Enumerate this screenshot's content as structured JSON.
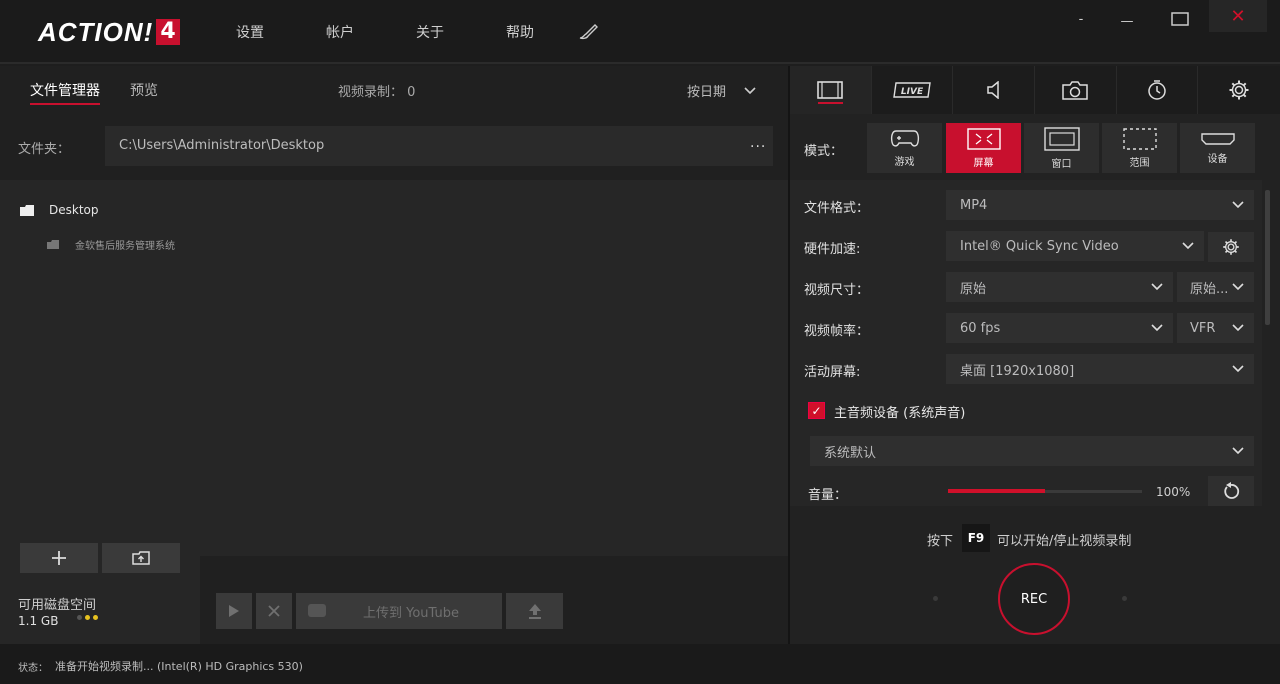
{
  "app": {
    "logo_text": "ACTION!",
    "logo_version": "4"
  },
  "menu": [
    {
      "label": "设置"
    },
    {
      "label": "帐户"
    },
    {
      "label": "关于"
    },
    {
      "label": "帮助"
    }
  ],
  "window": {
    "minimize_small": "-",
    "minimize": "—",
    "close": "✕"
  },
  "left": {
    "tabs": {
      "file_manager": "文件管理器",
      "preview": "预览"
    },
    "rec_count": "视频录制： 0",
    "sort": "按日期",
    "folder_label": "文件夹：",
    "folder_path": "C:\\Users\\Administrator\\Desktop",
    "folder_more": "...",
    "tree": [
      {
        "label": "Desktop"
      },
      {
        "label": "金软售后服务管理系统"
      }
    ],
    "disk_label": "可用磁盘空间",
    "disk_value": "1.1 GB",
    "youtube_label": "上传到 YouTube"
  },
  "right": {
    "tabs": [
      "video-icon",
      "live-icon",
      "audio-icon",
      "camera-icon",
      "timer-icon",
      "gear-icon"
    ],
    "live_text": "LIVE",
    "mode_label": "模式：",
    "modes": [
      {
        "label": "游戏"
      },
      {
        "label": "屏幕"
      },
      {
        "label": "窗口"
      },
      {
        "label": "范围"
      },
      {
        "label": "设备"
      }
    ],
    "settings": {
      "format_label": "文件格式：",
      "format_value": "MP4",
      "hw_label": "硬件加速:",
      "hw_value": "Intel® Quick Sync Video",
      "size_label": "视频尺寸：",
      "size_value": "原始",
      "size_value2": "原始...",
      "fps_label": "视频帧率：",
      "fps_value": "60 fps",
      "fps_mode": "VFR",
      "screen_label": "活动屏幕:",
      "screen_value": "桌面 [1920x1080]"
    },
    "audio": {
      "checkbox_label": "主音频设备 (系统声音)",
      "device": "系统默认",
      "volume_label": "音量：",
      "volume_value": "100%",
      "volume_fraction": 0.5
    },
    "hint_pre": "按下",
    "hint_key": "F9",
    "hint_post": "可以开始/停止视频录制",
    "rec_label": "REC"
  },
  "status": {
    "label": "状态：",
    "text": "准备开始视频录制... (Intel(R) HD Graphics 530)"
  },
  "colors": {
    "accent": "#c8102e",
    "disk_dot": "#e7c220"
  }
}
